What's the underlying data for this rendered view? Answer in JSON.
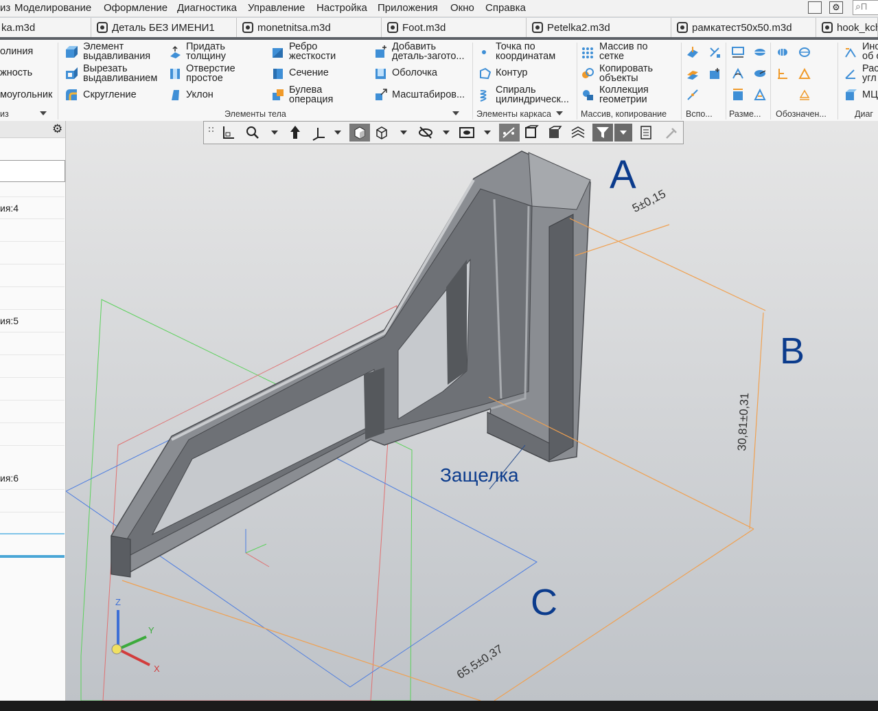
{
  "menu": [
    "Моделирование",
    "Оформление",
    "Диагностика",
    "Управление",
    "Настройка",
    "Приложения",
    "Окно",
    "Справка"
  ],
  "menu_lead": "из",
  "search_placeholder": "П",
  "tabs": [
    "ka.m3d",
    "Деталь БЕЗ ИМЕНИ1",
    "monetnitsa.m3d",
    "Foot.m3d",
    "Petelka2.m3d",
    "рамкатест50x50.m3d",
    "hook_kch"
  ],
  "ribbon": {
    "left_clip": [
      "олиния",
      "жность",
      "моугольник"
    ],
    "body": {
      "extrude": "Элемент\nвыдавливания",
      "cut": "Вырезать\nвыдавливанием",
      "fillet": "Скругление",
      "thicken": "Придать\nтолщину",
      "hole": "Отверстие\nпростое",
      "draft": "Уклон",
      "rib": "Ребро\nжесткости",
      "section": "Сечение",
      "boolean": "Булева\nоперация",
      "add_part": "Добавить\nдеталь-загото...",
      "shell": "Оболочка",
      "scale": "Масштабиров..."
    },
    "wire": {
      "point": "Точка по\nкоординатам",
      "contour": "Контур",
      "spiral": "Спираль\nцилиндрическ..."
    },
    "pattern": {
      "grid": "Массив по\nсетке",
      "copy": "Копировать\nобъекты",
      "collection": "Коллекция\nгеометрии"
    },
    "right_clip": [
      "Инс\nоб о",
      "Рас\nугл",
      "МЦ"
    ],
    "groups": [
      "из",
      "Элементы тела",
      "Элементы каркаса",
      "Массив, копирование",
      "Вспо...",
      "Разме...",
      "Обозначен...",
      "Диаг"
    ]
  },
  "tree": {
    "items": [
      "ия:4",
      "ия:5",
      "ия:6"
    ]
  },
  "annotations": {
    "A": "A",
    "B": "B",
    "C": "C",
    "latch": "Защелка",
    "dim_thickness": "5±0,15",
    "dim_height": "30,81±0,31",
    "dim_length": "65,5±0,37"
  },
  "axes": {
    "x": "X",
    "y": "Y",
    "z": "Z"
  },
  "colors": {
    "annotation_text": "#0b3b8c",
    "dimension": "#f0a050",
    "plane_green": "#5bd15b",
    "plane_red": "#e07070",
    "plane_blue": "#4a7be0"
  }
}
